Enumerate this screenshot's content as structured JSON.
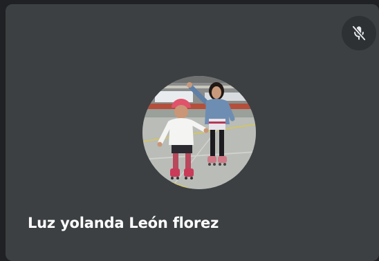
{
  "participant": {
    "name": "Luz yolanda León florez",
    "avatar_icon": "participant-photo",
    "mic_icon": "mic-off-icon",
    "mic_muted": true
  },
  "colors": {
    "page_background": "#202124",
    "tile_background": "#3c4043",
    "mute_button_background": "#2e3134",
    "text": "#ffffff"
  }
}
